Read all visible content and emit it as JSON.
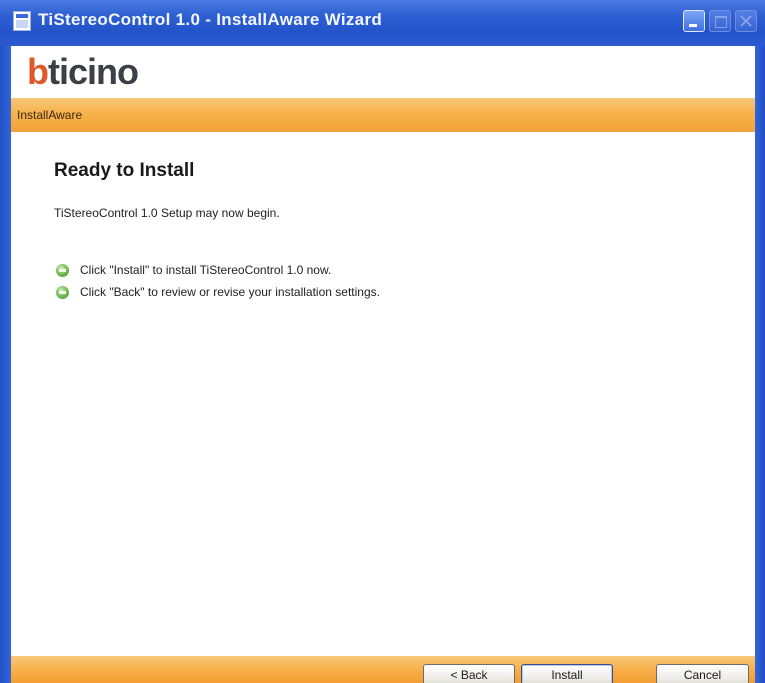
{
  "window": {
    "title": "TiStereoControl 1.0 - InstallAware Wizard"
  },
  "logo": {
    "first_letter": "b",
    "rest": "ticino",
    "colors": {
      "first_letter": "#e2572a",
      "rest": "#3b3f46"
    }
  },
  "header_bar": {
    "label": "InstallAware",
    "color": "#f6ae45"
  },
  "content": {
    "heading": "Ready to Install",
    "subtitle": "TiStereoControl 1.0 Setup may now begin.",
    "bullets": [
      {
        "icon": "green-bullet-icon",
        "text": "Click \"Install\" to install TiStereoControl 1.0 now."
      },
      {
        "icon": "green-bullet-icon",
        "text": "Click \"Back\" to review or revise your installation settings."
      }
    ]
  },
  "buttons": {
    "back": "< Back",
    "install": "Install",
    "cancel": "Cancel"
  },
  "colors": {
    "titlebar": "#2d5fd3",
    "accent_orange": "#f4a23a"
  }
}
